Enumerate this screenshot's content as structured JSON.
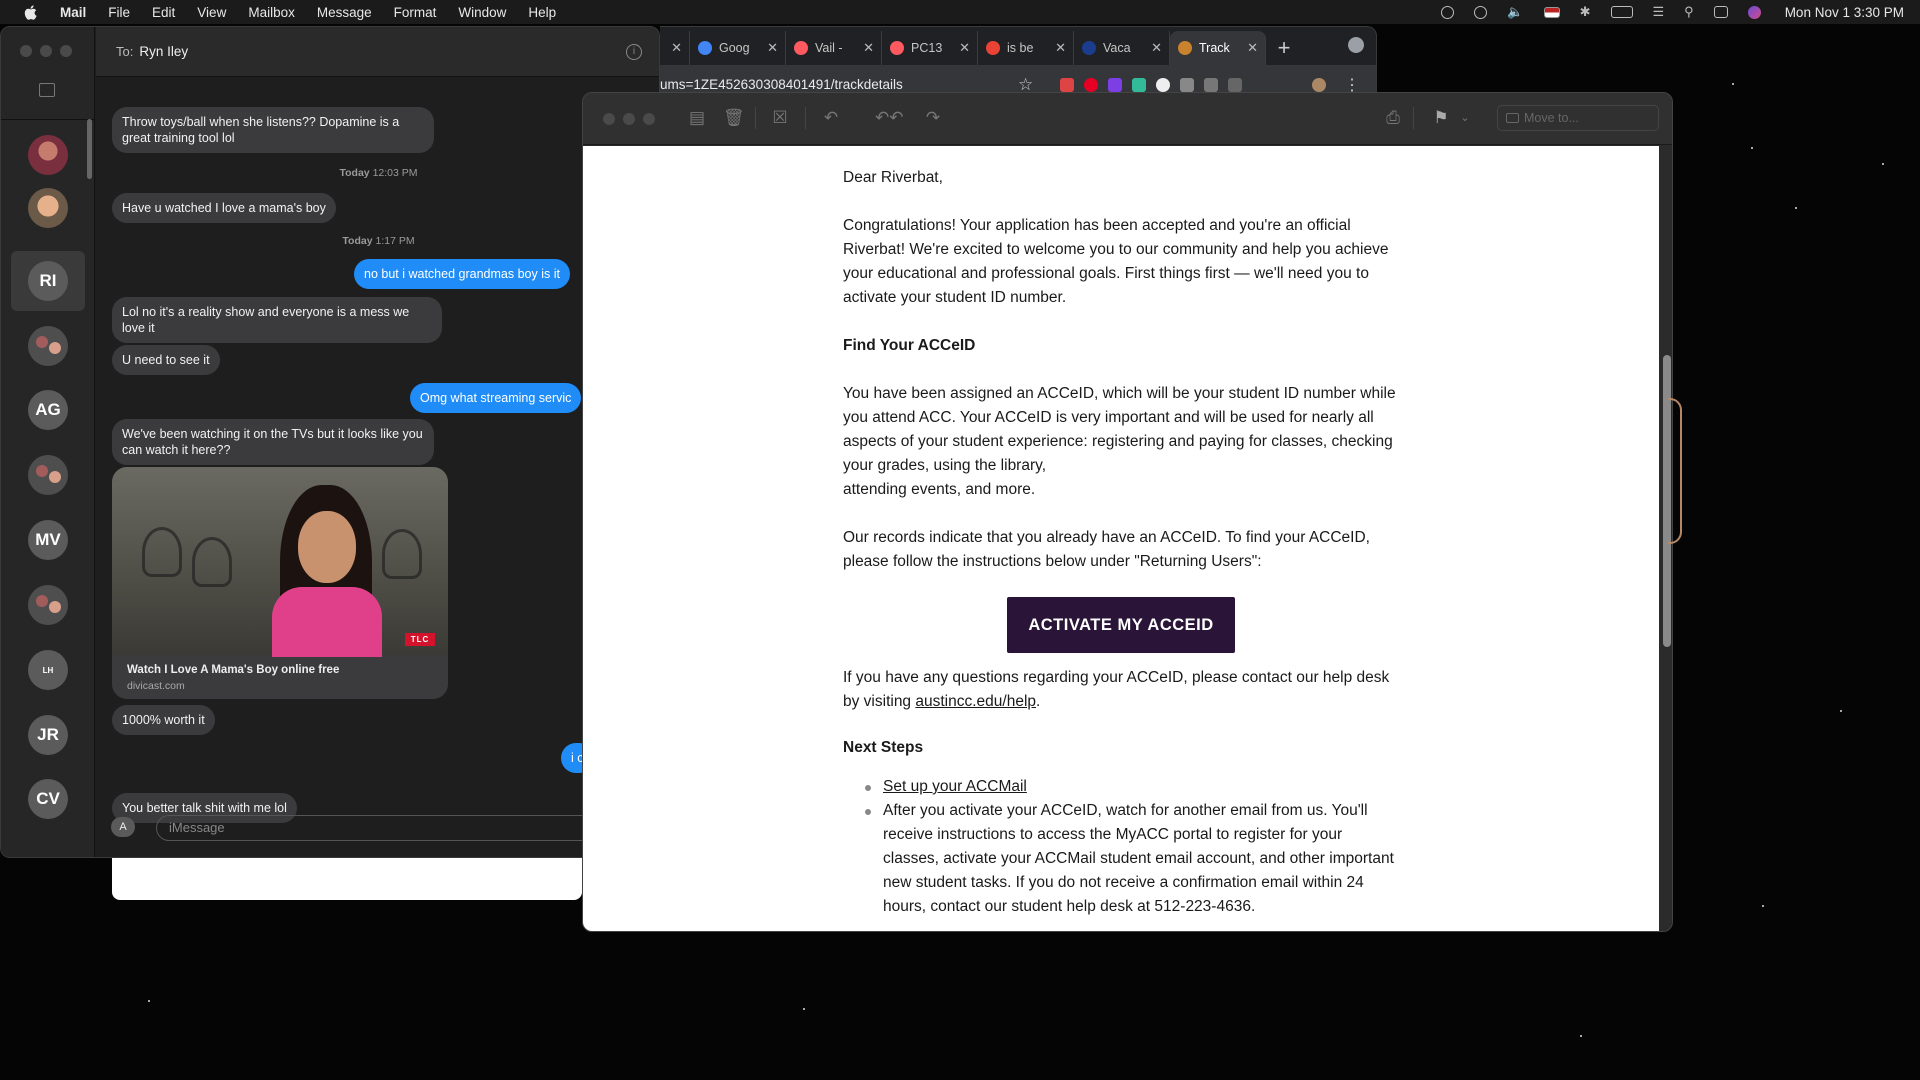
{
  "menubar": {
    "app": "Mail",
    "items": [
      "File",
      "Edit",
      "View",
      "Mailbox",
      "Message",
      "Format",
      "Window",
      "Help"
    ],
    "clock": "Mon Nov 1  3:30 PM"
  },
  "messages": {
    "header": {
      "to_label": "To:",
      "recipient": "Ryn Iley"
    },
    "sidebar": [
      {
        "initials": ""
      },
      {
        "initials": ""
      },
      {
        "initials": "RI"
      },
      {
        "initials": ""
      },
      {
        "initials": "AG"
      },
      {
        "initials": ""
      },
      {
        "initials": "MV"
      },
      {
        "initials": ""
      },
      {
        "initials": "LH"
      },
      {
        "initials": "JR"
      },
      {
        "initials": "CV"
      }
    ],
    "transcript": {
      "m1": "Throw toys/ball when she listens?? Dopamine is a great training tool lol",
      "ts1_day": "Today",
      "ts1_time": "12:03 PM",
      "m2": "Have u watched I love a mama's boy",
      "ts2_day": "Today",
      "ts2_time": "1:17 PM",
      "m3": "no but i watched grandmas boy is it",
      "m4": "Lol no it's a reality show and everyone is a mess we love it",
      "m5": "U need to see it",
      "m6": "Omg what streaming servic",
      "m7": "We've been watching it on the TVs but it looks like you can watch it here??",
      "link_title": "Watch I Love A Mama's Boy online free",
      "link_domain": "divicast.com",
      "link_badge": "TLC",
      "m8": "1000% worth it",
      "m9": "i c",
      "m10": "You better talk shit with me lol"
    },
    "input_placeholder": "iMessage"
  },
  "chrome": {
    "tabs": [
      {
        "label": "Goog",
        "color": "#4285f4"
      },
      {
        "label": "Vail -",
        "color": "#ff5a5f"
      },
      {
        "label": "PC13",
        "color": "#ff5a5f"
      },
      {
        "label": "is be",
        "color": "#ea4335"
      },
      {
        "label": "Vaca",
        "color": "#1a3d8f"
      },
      {
        "label": "Track",
        "color": "#c9822e"
      }
    ],
    "url": "ums=1ZE452630308401491/trackdetails"
  },
  "mail": {
    "move_to_placeholder": "Move to...",
    "email": {
      "greeting": "Dear Riverbat,",
      "p1": "Congratulations! Your application has been accepted and you're an official Riverbat! We're excited to welcome you to our community and help you achieve your educational and professional goals. First things first — we'll need you to activate your student ID number.",
      "h1": "Find Your ACCeID",
      "p2": "You have been assigned an ACCeID, which will be your student ID number while you attend ACC. Your ACCeID is very important and will be used for nearly all aspects of your student experience: registering and paying for classes, checking your grades, using the library,",
      "p2b": "attending events, and more.",
      "p3": "Our records indicate that you already have an ACCeID. To find your ACCeID, please follow the instructions below under \"Returning Users\":",
      "button": "ACTIVATE MY ACCEID",
      "p4_pre": "If you have any questions regarding your ACCeID, please contact our help desk by visiting ",
      "p4_link": "austincc.edu/help",
      "p4_post": ".",
      "h2": "Next Steps",
      "step1": "Set up your ACCMail",
      "step2": "After you activate your ACCeID, watch for another email from us. You'll receive instructions to access the MyACC portal to register for your classes, activate your ACCMail student email account, and other important new student tasks. If you do not receive a confirmation email within 24 hours, contact our student help desk at 512-223-4636."
    }
  }
}
